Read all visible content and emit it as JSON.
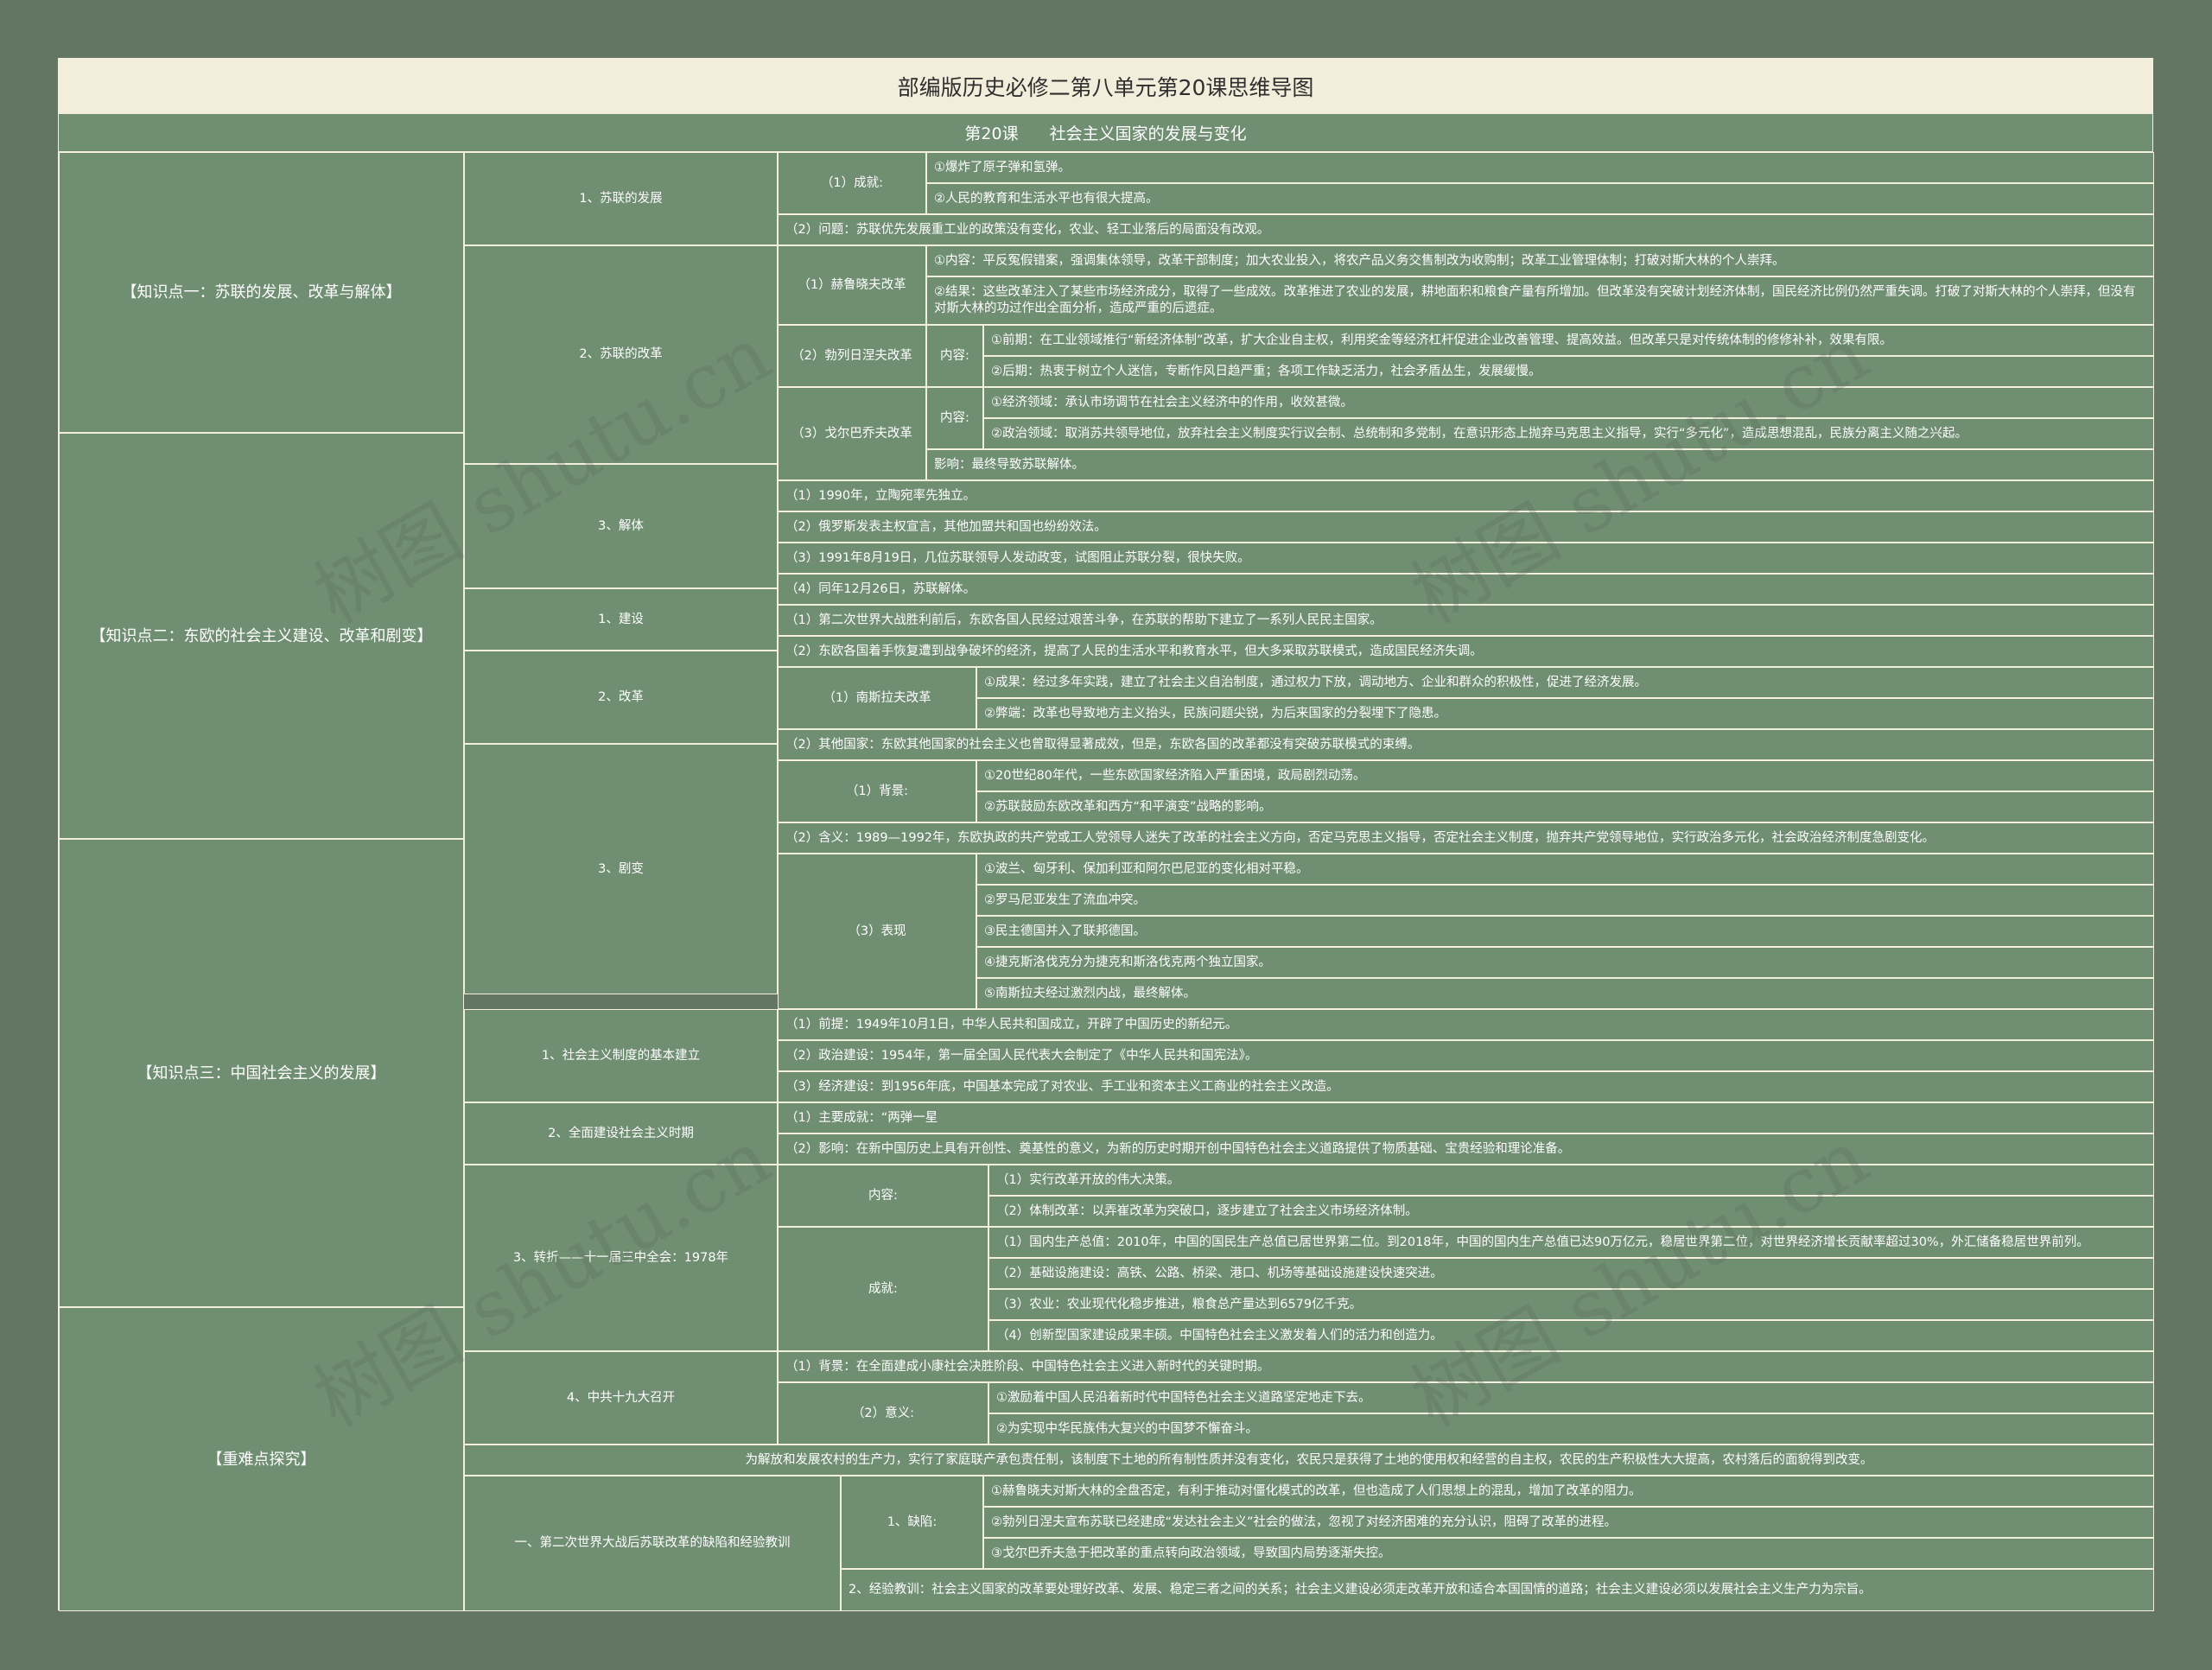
{
  "title": "部编版历史必修二第八单元第20课思维导图",
  "subtitle": {
    "lesson": "第20课",
    "name": "社会主义国家的发展与变化"
  },
  "watermark": "树图 shutu.cn",
  "colors": {
    "page_bg": "#637563",
    "cell_bg": "#6f8e72",
    "title_bg": "#f3eedb",
    "border": "#f3efdd",
    "text": "#ffffff"
  },
  "k1": {
    "label": "【知识点一：苏联的发展、改革与解体】",
    "dev": {
      "label": "1、苏联的发展",
      "ach": "（1）成就:",
      "a1": "①爆炸了原子弹和氢弹。",
      "a2": "②人民的教育和生活水平也有很大提高。",
      "prob": "（2）问题：苏联优先发展重工业的政策没有变化，农业、轻工业落后的局面没有改观。"
    },
    "reform": {
      "label": "2、苏联的改革",
      "h": {
        "label": "（1）赫鲁晓夫改革",
        "c": "①内容：平反冤假错案，强调集体领导，改革干部制度；加大农业投入，将农产品义务交售制改为收购制；改革工业管理体制；打破对斯大林的个人崇拜。",
        "r": "②结果：这些改革注入了某些市场经济成分，取得了一些成效。改革推进了农业的发展，耕地面积和粮食产量有所增加。但改革没有突破计划经济体制，国民经济比例仍然严重失调。打破了对斯大林的个人崇拜，但没有对斯大林的功过作出全面分析，造成严重的后遗症。"
      },
      "b": {
        "label": "（2）勃列日涅夫改革",
        "content": "内容:",
        "e": "①前期：在工业领域推行“新经济体制”改革，扩大企业自主权，利用奖金等经济杠杆促进企业改善管理、提高效益。但改革只是对传统体制的修修补补，效果有限。",
        "l": "②后期：热衷于树立个人迷信，专断作风日趋严重；各项工作缺乏活力，社会矛盾丛生，发展缓慢。"
      },
      "g": {
        "label": "（3）戈尔巴乔夫改革",
        "content": "内容:",
        "e": "①经济领域：承认市场调节在社会主义经济中的作用，收效甚微。",
        "p": "②政治领域：取消苏共领导地位，放弃社会主义制度实行议会制、总统制和多党制，在意识形态上抛弃马克思主义指导，实行“多元化”，造成思想混乱，民族分离主义随之兴起。",
        "i": "影响：最终导致苏联解体。"
      }
    },
    "dis": {
      "label": "3、解体",
      "i1": "（1）1990年，立陶宛率先独立。",
      "i2": "（2）俄罗斯发表主权宣言，其他加盟共和国也纷纷效法。",
      "i3": "（3）1991年8月19日，几位苏联领导人发动政变，试图阻止苏联分裂，很快失败。",
      "i4": "（4）同年12月26日，苏联解体。"
    }
  },
  "k2": {
    "label": "【知识点二：东欧的社会主义建设、改革和剧变】",
    "build": {
      "label": "1、建设",
      "i1": "（1）第二次世界大战胜利前后，东欧各国人民经过艰苦斗争，在苏联的帮助下建立了一系列人民民主国家。",
      "i2": "（2）东欧各国着手恢复遭到战争破坏的经济，提高了人民的生活水平和教育水平，但大多采取苏联模式，造成国民经济失调。"
    },
    "reform": {
      "label": "2、改革",
      "y": "（1）南斯拉夫改革",
      "y1": "①成果：经过多年实践，建立了社会主义自治制度，通过权力下放，调动地方、企业和群众的积极性，促进了经济发展。",
      "y2": "②弊端：改革也导致地方主义抬头，民族问题尖锐，为后来国家的分裂埋下了隐患。",
      "o": "（2）其他国家：东欧其他国家的社会主义也曾取得显著成效，但是，东欧各国的改革都没有突破苏联模式的束缚。"
    },
    "change": {
      "label": "3、剧变",
      "bg": "（1）背景:",
      "bg1": "①20世纪80年代，一些东欧国家经济陷入严重困境，政局剧烈动荡。",
      "bg2": "②苏联鼓励东欧改革和西方“和平演变”战略的影响。",
      "mean": "（2）含义：1989—1992年，东欧执政的共产党或工人党领导人迷失了改革的社会主义方向，否定马克思主义指导，否定社会主义制度，抛弃共产党领导地位，实行政治多元化，社会政治经济制度急剧变化。",
      "show": "（3）表现",
      "s1": "①波兰、匈牙利、保加利亚和阿尔巴尼亚的变化相对平稳。",
      "s2": "②罗马尼亚发生了流血冲突。",
      "s3": "③民主德国并入了联邦德国。",
      "s4": "④捷克斯洛伐克分为捷克和斯洛伐克两个独立国家。",
      "s5": "⑤南斯拉夫经过激烈内战，最终解体。"
    }
  },
  "k3": {
    "label": "【知识点三：中国社会主义的发展】",
    "est": {
      "label": "1、社会主义制度的基本建立",
      "i1": "（1）前提：1949年10月1日，中华人民共和国成立，开辟了中国历史的新纪元。",
      "i2": "（2）政治建设：1954年，第一届全国人民代表大会制定了《中华人民共和国宪法》。",
      "i3": "（3）经济建设：到1956年底，中国基本完成了对农业、手工业和资本主义工商业的社会主义改造。"
    },
    "full": {
      "label": "2、全面建设社会主义时期",
      "i1": "（1）主要成就：“两弹一星",
      "i2": "（2）影响：在新中国历史上具有开创性、奠基性的意义，为新的历史时期开创中国特色社会主义道路提供了物质基础、宝贵经验和理论准备。"
    },
    "turn": {
      "label": "3、转折——十一届三中全会：1978年",
      "content": "内容:",
      "c1": "（1）实行改革开放的伟大决策。",
      "c2": "（2）体制改革：以弄崔改革为突破口，逐步建立了社会主义市场经济体制。",
      "ach": "成就:",
      "a1": "（1）国内生产总值：2010年，中国的国民生产总值已居世界第二位。到2018年，中国的国内生产总值已达90万亿元，稳居世界第二位，对世界经济增长贡献率超过30%，外汇储备稳居世界前列。",
      "a2": "（2）基础设施建设：高铁、公路、桥梁、港口、机场等基础设施建设快速突进。",
      "a3": "（3）农业：农业现代化稳步推进，粮食总产量达到6579亿千克。",
      "a4": "（4）创新型国家建设成果丰硕。中国特色社会主义激发着人们的活力和创造力。"
    },
    "cong": {
      "label": "4、中共十九大召开",
      "bg": "（1）背景：在全面建成小康社会决胜阶段、中国特色社会主义进入新时代的关键时期。",
      "mean": "（2）意义:",
      "m1": "①激励着中国人民沿着新时代中国特色社会主义道路坚定地走下去。",
      "m2": "②为实现中华民族伟大复兴的中国梦不懈奋斗。"
    },
    "note": "为解放和发展农村的生产力，实行了家庭联产承包责任制，该制度下土地的所有制性质并没有变化，农民只是获得了土地的使用权和经营的自主权，农民的生产积极性大大提高，农村落后的面貌得到改变。"
  },
  "key": {
    "label": "【重难点探究】",
    "topic": "一、第二次世界大战后苏联改革的缺陷和经验教训",
    "def": "1、缺陷:",
    "d1": "①赫鲁晓夫对斯大林的全盘否定，有利于推动对僵化模式的改革，但也造成了人们思想上的混乱，增加了改革的阻力。",
    "d2": "②勃列日涅夫宣布苏联已经建成“发达社会主义”社会的做法，忽视了对经济困难的充分认识，阻碍了改革的进程。",
    "d3": "③戈尔巴乔夫急于把改革的重点转向政治领域，导致国内局势逐渐失控。",
    "lesson": "2、经验教训：社会主义国家的改革要处理好改革、发展、稳定三者之间的关系；社会主义建设必须走改革开放和适合本国国情的道路；社会主义建设必须以发展社会主义生产力为宗旨。"
  }
}
